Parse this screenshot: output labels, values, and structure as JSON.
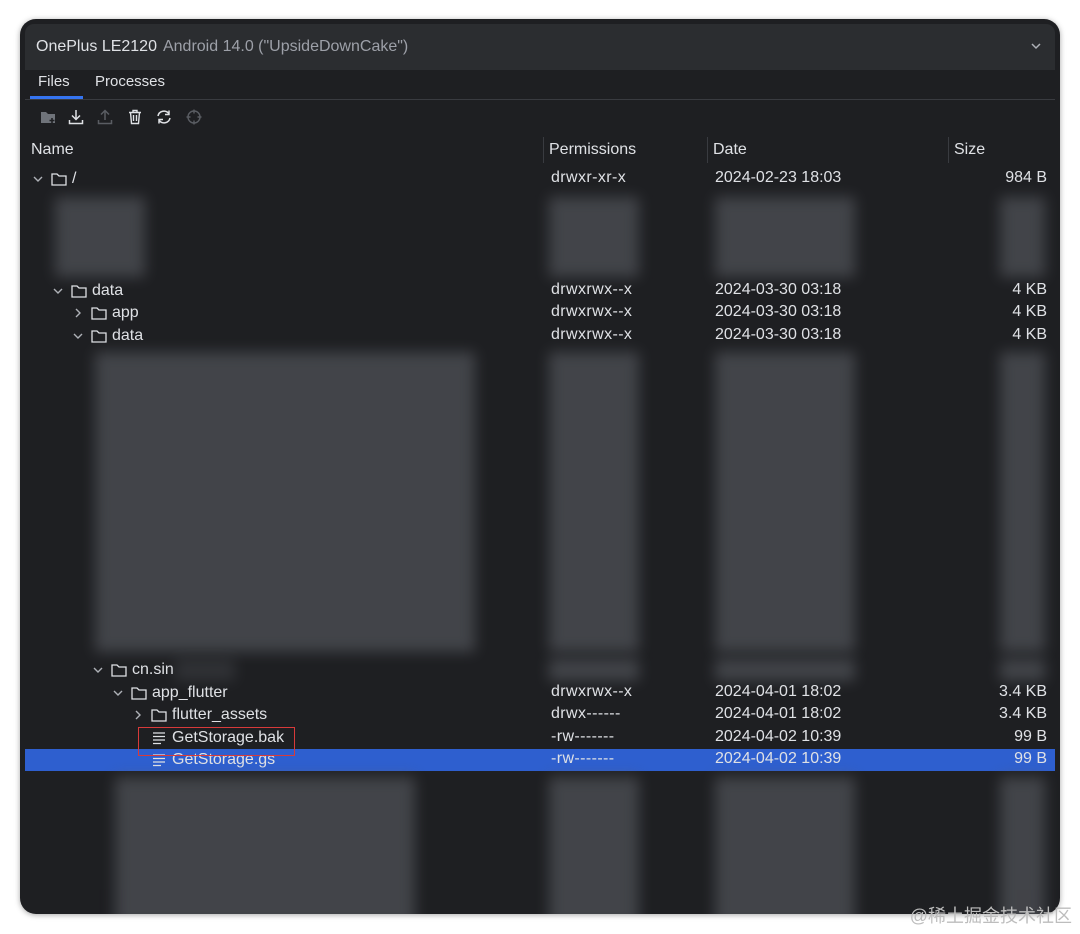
{
  "device": {
    "name": "OnePlus LE2120",
    "subtitle": "Android 14.0 (\"UpsideDownCake\")",
    "dropdown_icon": "chevron-down-icon"
  },
  "tabs": [
    {
      "label": "Files",
      "active": true
    },
    {
      "label": "Processes",
      "active": false
    }
  ],
  "toolbar": {
    "icons": [
      "new-folder-icon",
      "download-icon",
      "upload-icon",
      "delete-icon",
      "refresh-icon",
      "locate-icon"
    ]
  },
  "columns": {
    "name": "Name",
    "permissions": "Permissions",
    "date": "Date",
    "size": "Size"
  },
  "rows": [
    {
      "name": "/",
      "type": "folder",
      "expanded": true,
      "permissions": "drwxr-xr-x",
      "date": "2024-02-23 18:03",
      "size": "984 B"
    },
    {
      "name": "data",
      "type": "folder",
      "expanded": true,
      "permissions": "drwxrwx--x",
      "date": "2024-03-30 03:18",
      "size": "4 KB"
    },
    {
      "name": "app",
      "type": "folder",
      "expanded": false,
      "permissions": "drwxrwx--x",
      "date": "2024-03-30 03:18",
      "size": "4 KB"
    },
    {
      "name": "data",
      "type": "folder",
      "expanded": true,
      "permissions": "drwxrwx--x",
      "date": "2024-03-30 03:18",
      "size": "4 KB"
    },
    {
      "name": "cn.sin",
      "type": "folder",
      "expanded": true,
      "permissions": "",
      "date": "",
      "size": ""
    },
    {
      "name": "app_flutter",
      "type": "folder",
      "expanded": true,
      "permissions": "drwxrwx--x",
      "date": "2024-04-01 18:02",
      "size": "3.4 KB"
    },
    {
      "name": "flutter_assets",
      "type": "folder",
      "expanded": false,
      "permissions": "drwx------",
      "date": "2024-04-01 18:02",
      "size": "3.4 KB"
    },
    {
      "name": "GetStorage.bak",
      "type": "file",
      "permissions": "-rw-------",
      "date": "2024-04-02 10:39",
      "size": "99 B"
    },
    {
      "name": "GetStorage.gs",
      "type": "file",
      "selected": true,
      "permissions": "-rw-------",
      "date": "2024-04-02 10:39",
      "size": "99 B"
    }
  ],
  "watermark": "@稀土掘金技术社区",
  "colors": {
    "background": "#1e1f22",
    "selection": "#2e5fcf",
    "tab_accent": "#3574f0",
    "highlight_box": "#d83a3a"
  }
}
